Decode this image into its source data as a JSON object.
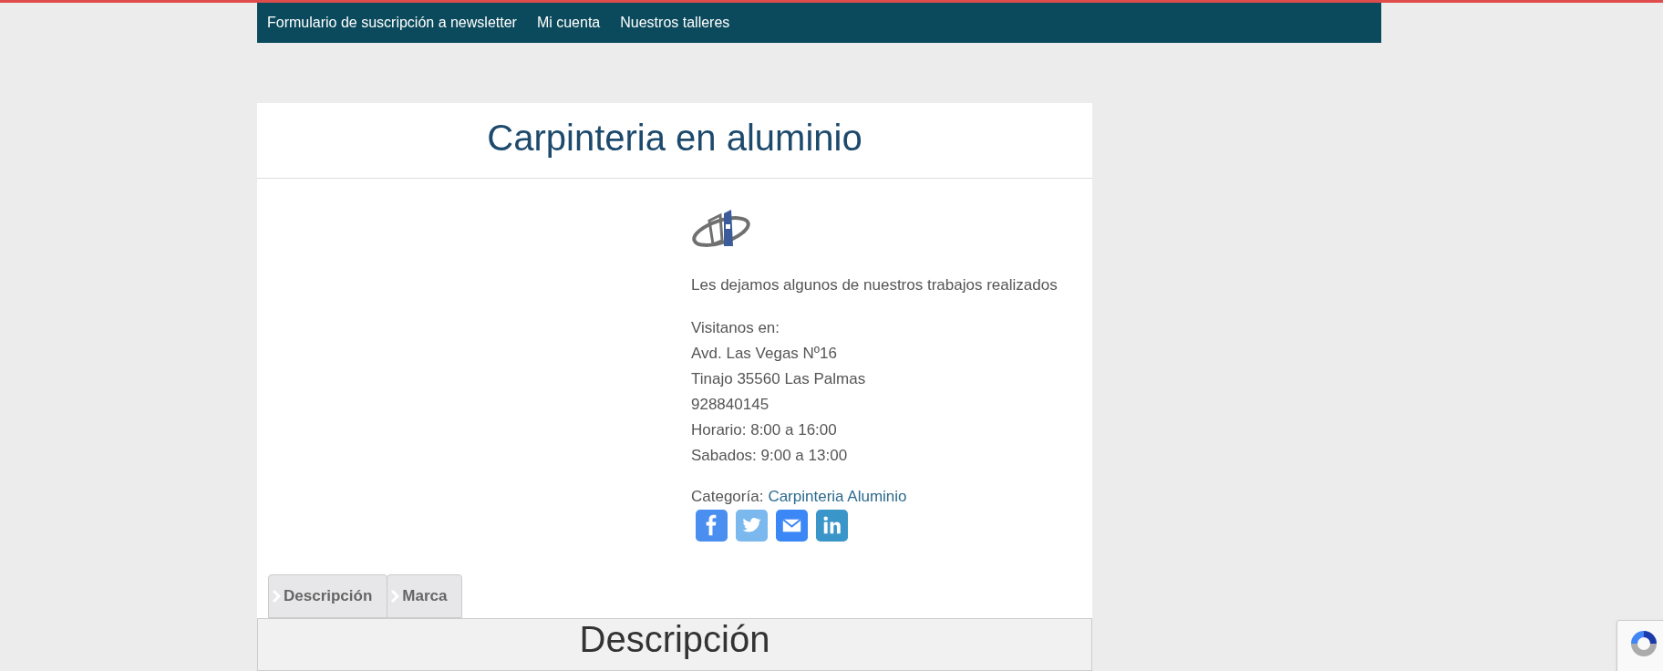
{
  "nav": {
    "items": [
      {
        "label": "Formulario de suscripción a newsletter"
      },
      {
        "label": "Mi cuenta"
      },
      {
        "label": "Nuestros talleres"
      }
    ]
  },
  "product": {
    "title": "Carpinteria en aluminio",
    "intro": "Les dejamos algunos de nuestros trabajos realizados",
    "address_lines": [
      "Visitanos en:",
      "Avd. Las Vegas Nº16",
      "Tinajo 35560 Las Palmas",
      "928840145",
      "Horario: 8:00 a 16:00",
      "Sabados: 9:00 a 13:00"
    ],
    "category_label": "Categoría:",
    "category": "Carpinteria Aluminio",
    "share": [
      {
        "kind": "facebook"
      },
      {
        "kind": "twitter"
      },
      {
        "kind": "email"
      },
      {
        "kind": "linkedin"
      }
    ]
  },
  "tabs": [
    {
      "label": "Descripción"
    },
    {
      "label": "Marca"
    }
  ],
  "panel": {
    "heading": "Descripción"
  }
}
